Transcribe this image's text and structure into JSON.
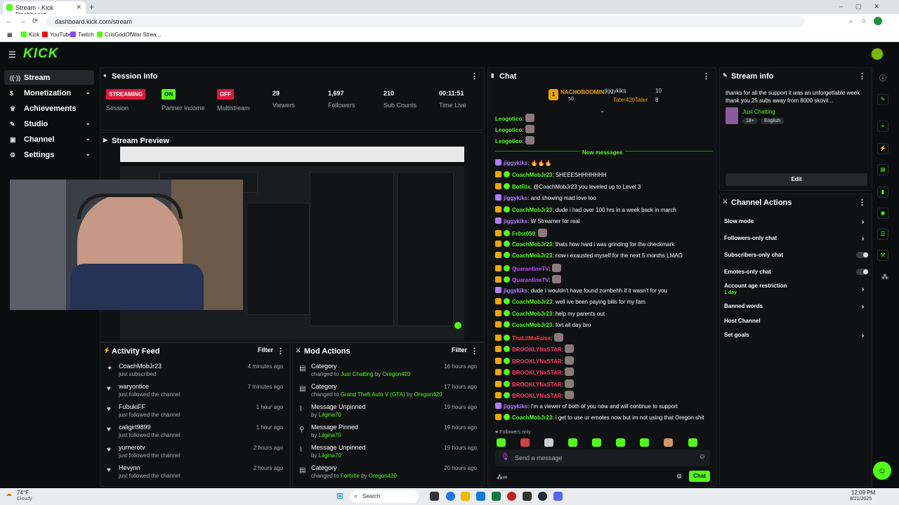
{
  "browser": {
    "tab_title": "Stream - Kick Dashboard",
    "url": "dashboard.kick.com/stream",
    "bookmarks": [
      "Kick",
      "YouTube",
      "Twitch",
      "CrisGodOfWar Strea..."
    ]
  },
  "app": {
    "logo": "KICK"
  },
  "nav": {
    "items": [
      {
        "label": "Stream",
        "icon": "broadcast-icon"
      },
      {
        "label": "Monetization",
        "icon": "dollar-icon"
      },
      {
        "label": "Achievements",
        "icon": "trophy-icon"
      },
      {
        "label": "Studio",
        "icon": "studio-icon"
      },
      {
        "label": "Channel",
        "icon": "channel-icon"
      },
      {
        "label": "Settings",
        "icon": "gear-icon"
      }
    ]
  },
  "session": {
    "title": "Session Info",
    "streaming_badge": "STREAMING",
    "session_label": "Session",
    "partner_badge": "ON",
    "partner_label": "Partner Income",
    "multi_badge": "OFF",
    "multi_label": "Multistream",
    "viewers": "29",
    "viewers_label": "Viewers",
    "followers": "1,697",
    "followers_label": "Followers",
    "subs": "210",
    "subs_label": "Sub Counts",
    "time_live": "00:11:51",
    "time_live_label": "Time Live"
  },
  "preview": {
    "title": "Stream Preview"
  },
  "activity": {
    "title": "Activity Feed",
    "filter": "Filter",
    "rows": [
      {
        "name": "CoachMobJr23",
        "sub": "just subscribed",
        "time": "4 minutes ago"
      },
      {
        "name": "waryontice",
        "sub": "just followed the channel",
        "time": "7 minutes ago"
      },
      {
        "name": "FubukiFF",
        "sub": "just followed the channel",
        "time": "1 hour ago"
      },
      {
        "name": "caligirl9899",
        "sub": "just followed the channel",
        "time": "1 hour ago"
      },
      {
        "name": "yurnerotv",
        "sub": "just followed the channel",
        "time": "2 hours ago"
      },
      {
        "name": "Hevynn",
        "sub": "just followed the channel",
        "time": "2 hours ago"
      }
    ]
  },
  "mod": {
    "title": "Mod Actions",
    "filter": "Filter",
    "rows": [
      {
        "title": "Category",
        "pre": "changed to",
        "target": "Just Chatting",
        "by": "by",
        "user": "Oregon420",
        "time": "16 hours ago"
      },
      {
        "title": "Category",
        "pre": "changed to",
        "target": "Grand Theft Auto V (GTA)",
        "by": "by",
        "user": "Oregon420",
        "time": "17 hours ago"
      },
      {
        "title": "Message Unpinned",
        "pre": "by",
        "target": "",
        "by": "",
        "user": "Lilgina70",
        "time": "19 hours ago"
      },
      {
        "title": "Message Pinned",
        "pre": "by",
        "target": "",
        "by": "",
        "user": "Lilgina70",
        "time": "19 hours ago"
      },
      {
        "title": "Message Unpinned",
        "pre": "by",
        "target": "",
        "by": "",
        "user": "Lilgina70",
        "time": "19 hours ago"
      },
      {
        "title": "Category",
        "pre": "changed to",
        "target": "Fortnite",
        "by": "by",
        "user": "Oregon420",
        "time": "20 hours ago"
      }
    ]
  },
  "chat": {
    "title": "Chat",
    "leader_name": "NACHOBOOMIN",
    "leader_count": "50",
    "leader2_name": "jiggykiks",
    "leader2_count": "10",
    "leader3_name": "Tater420Tater",
    "leader3_count": "8",
    "new_messages": "New messages",
    "followers_only": "Followers only",
    "placeholder": "Send a message",
    "send": "Chat",
    "messages": [
      {
        "user": "Leogotico",
        "text": "",
        "color": "#53fc18"
      },
      {
        "user": "Leogotico",
        "text": "",
        "color": "#53fc18"
      },
      {
        "user": "Leogotico",
        "text": "",
        "color": "#53fc18"
      },
      {
        "user": "jiggykiks",
        "text": "🔥🔥🔥",
        "color": "#b57bff"
      },
      {
        "user": "CoachMobJr23",
        "text": "SHEEESHHHHHHH",
        "color": "#53fc18"
      },
      {
        "user": "BotRix",
        "text": "@CoachMobJr23 you leveled up to Level 3",
        "color": "#53fc18"
      },
      {
        "user": "jiggykiks",
        "text": "and showing mad love too",
        "color": "#b57bff"
      },
      {
        "user": "CoachMobJr23",
        "text": "dude i had over 100 hrs in a week back in march",
        "color": "#53fc18"
      },
      {
        "user": "jiggykiks",
        "text": "W Streamer for real",
        "color": "#b57bff"
      },
      {
        "user": "Fr0st059",
        "text": "",
        "color": "#53fc18"
      },
      {
        "user": "CoachMobJr23",
        "text": "thats how hard i was grinding for the checkmark",
        "color": "#53fc18"
      },
      {
        "user": "CoachMobJr23",
        "text": "now i exausted myself for the next 5 months LMAO",
        "color": "#53fc18"
      },
      {
        "user": "QuarantineTV",
        "text": "",
        "color": "#c24cff"
      },
      {
        "user": "QuarantineTV",
        "text": "",
        "color": "#c24cff"
      },
      {
        "user": "jiggykiks",
        "text": "dude I wouldn't have found zombehh if it wasn't for you",
        "color": "#b57bff"
      },
      {
        "user": "CoachMobJr23",
        "text": "well ive been paying bills for my fam",
        "color": "#53fc18"
      },
      {
        "user": "CoachMobJr23",
        "text": "help my parents out",
        "color": "#53fc18"
      },
      {
        "user": "CoachMobJr23",
        "text": "fort all day bro",
        "color": "#53fc18"
      },
      {
        "user": "ThaLilMaFalse",
        "text": "",
        "color": "#ff3b3b"
      },
      {
        "user": "BROOKLYNxSTAR",
        "text": "",
        "color": "#ff3b6b"
      },
      {
        "user": "BROOKLYNxSTAR",
        "text": "",
        "color": "#ff3b6b"
      },
      {
        "user": "BROOKLYNxSTAR",
        "text": "",
        "color": "#ff3b6b"
      },
      {
        "user": "BROOKLYNxSTAR",
        "text": "",
        "color": "#ff3b6b"
      },
      {
        "user": "BROOKLYNxSTAR",
        "text": "",
        "color": "#ff3b6b"
      },
      {
        "user": "jiggykiks",
        "text": "I'm a viewer of both of you now and will continue to support",
        "color": "#b57bff"
      },
      {
        "user": "CoachMobJr23",
        "text": "i get to use ur emotes now but im not using that Oregon shit",
        "color": "#53fc18"
      }
    ]
  },
  "stream_info": {
    "title": "Stream info",
    "stream_title": "thanks for all the support it was an unforgettable week thank you 25 subs away from 8000 skovil...",
    "category": "Just Chatting",
    "tag1": "18+",
    "tag2": "English",
    "edit": "Edit"
  },
  "channel_actions": {
    "title": "Channel Actions",
    "slow": "Slow mode",
    "followers_only": "Followers-only chat",
    "subs_only": "Subscribers-only chat",
    "emotes_only": "Emotes-only chat",
    "age": "Account age restriction",
    "age_value": "1 day",
    "banned": "Banned words",
    "host": "Host Channel",
    "goals": "Set goals"
  },
  "taskbar": {
    "weather_temp": "74°F",
    "weather_cond": "Cloudy",
    "search": "Search",
    "time": "12:09 PM",
    "date": "8/21/2025"
  },
  "colors": {
    "accent": "#53fc18",
    "streaming": "#e0173d",
    "on": "#53fc18",
    "off": "#e0173d"
  }
}
